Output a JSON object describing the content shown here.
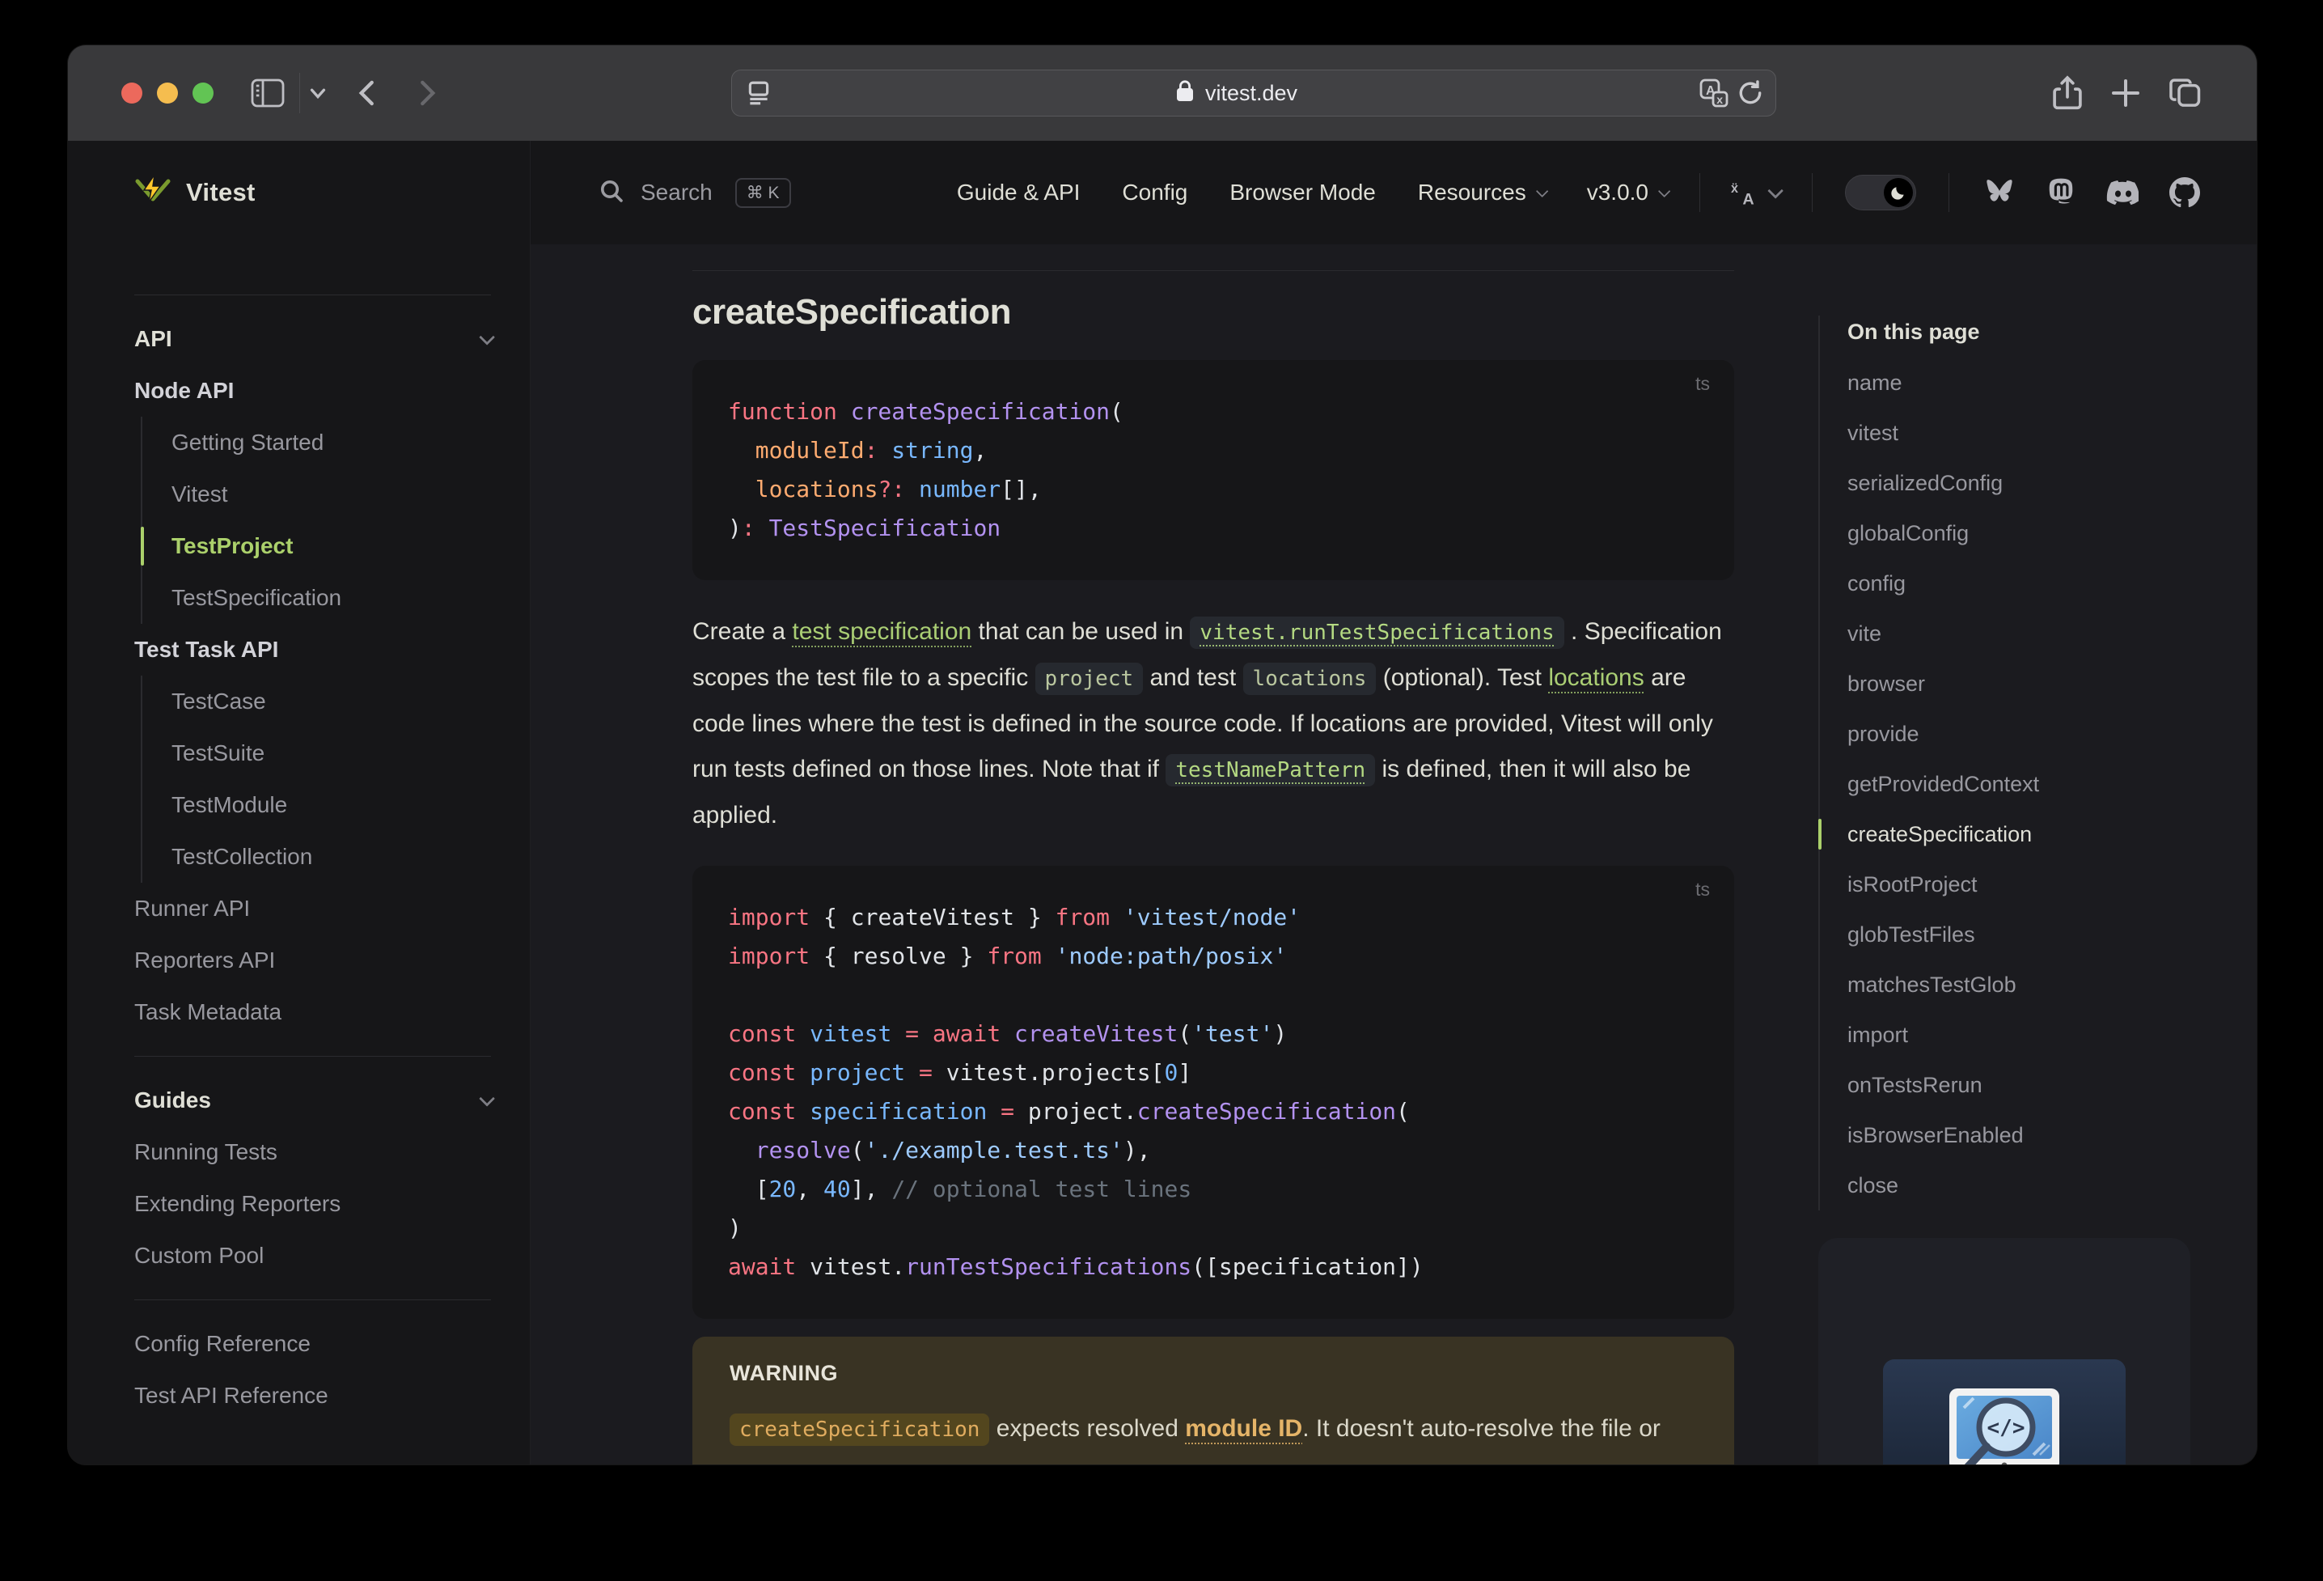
{
  "colors": {
    "brand": "#abd06b",
    "code_keyword": "#f97583",
    "code_function": "#b392f0",
    "code_string": "#9ecbff",
    "code_constant": "#79b8ff",
    "code_param": "#ffab70",
    "code_plain": "#e1e4e8",
    "code_comment": "#6a737d",
    "warning_accent": "#e5b468",
    "traffic_red": "#ec695c",
    "traffic_yellow": "#f5bd4f",
    "traffic_green": "#62c454"
  },
  "browser": {
    "url": "vitest.dev"
  },
  "navbar": {
    "search_label": "Search",
    "search_shortcut": "⌘ K",
    "links": [
      "Guide & API",
      "Config",
      "Browser Mode"
    ],
    "menus": [
      "Resources",
      "v3.0.0"
    ]
  },
  "sidebar": {
    "logo_text": "Vitest",
    "groups": [
      {
        "title": "API",
        "children": [
          {
            "type": "section",
            "label": "Node API"
          },
          {
            "type": "subitem",
            "label": "Getting Started"
          },
          {
            "type": "subitem",
            "label": "Vitest"
          },
          {
            "type": "subitem",
            "label": "TestProject",
            "active": true
          },
          {
            "type": "subitem",
            "label": "TestSpecification"
          },
          {
            "type": "section",
            "label": "Test Task API"
          },
          {
            "type": "subitem",
            "label": "TestCase"
          },
          {
            "type": "subitem",
            "label": "TestSuite"
          },
          {
            "type": "subitem",
            "label": "TestModule"
          },
          {
            "type": "subitem",
            "label": "TestCollection"
          },
          {
            "type": "item",
            "label": "Runner API"
          },
          {
            "type": "item",
            "label": "Reporters API"
          },
          {
            "type": "item",
            "label": "Task Metadata"
          }
        ]
      },
      {
        "title": "Guides",
        "children": [
          {
            "type": "item",
            "label": "Running Tests"
          },
          {
            "type": "item",
            "label": "Extending Reporters"
          },
          {
            "type": "item",
            "label": "Custom Pool"
          }
        ]
      },
      {
        "title": null,
        "children": [
          {
            "type": "item",
            "label": "Config Reference"
          },
          {
            "type": "item",
            "label": "Test API Reference"
          }
        ]
      }
    ]
  },
  "doc": {
    "heading": "createSpecification",
    "code_blocks": [
      {
        "lang": "ts",
        "lines": [
          [
            [
              "k",
              "function"
            ],
            [
              "d",
              " "
            ],
            [
              "f",
              "createSpecification"
            ],
            [
              "d",
              "("
            ]
          ],
          [
            [
              "d",
              "  "
            ],
            [
              "p",
              "moduleId"
            ],
            [
              "k",
              ":"
            ],
            [
              "d",
              " "
            ],
            [
              "v",
              "string"
            ],
            [
              "d",
              ","
            ]
          ],
          [
            [
              "d",
              "  "
            ],
            [
              "p",
              "locations"
            ],
            [
              "k",
              "?:"
            ],
            [
              "d",
              " "
            ],
            [
              "v",
              "number"
            ],
            [
              "d",
              "[],"
            ]
          ],
          [
            [
              "d",
              ")"
            ],
            [
              "k",
              ":"
            ],
            [
              "d",
              " "
            ],
            [
              "f",
              "TestSpecification"
            ]
          ]
        ]
      },
      {
        "lang": "ts",
        "lines": [
          [
            [
              "k",
              "import"
            ],
            [
              "d",
              " { createVitest } "
            ],
            [
              "k",
              "from"
            ],
            [
              "d",
              " "
            ],
            [
              "s",
              "'vitest/node'"
            ]
          ],
          [
            [
              "k",
              "import"
            ],
            [
              "d",
              " { resolve } "
            ],
            [
              "k",
              "from"
            ],
            [
              "d",
              " "
            ],
            [
              "s",
              "'node:path/posix'"
            ]
          ],
          [],
          [
            [
              "k",
              "const"
            ],
            [
              "d",
              " "
            ],
            [
              "v",
              "vitest"
            ],
            [
              "d",
              " "
            ],
            [
              "k",
              "="
            ],
            [
              "d",
              " "
            ],
            [
              "k",
              "await"
            ],
            [
              "d",
              " "
            ],
            [
              "f",
              "createVitest"
            ],
            [
              "d",
              "("
            ],
            [
              "s",
              "'test'"
            ],
            [
              "d",
              ")"
            ]
          ],
          [
            [
              "k",
              "const"
            ],
            [
              "d",
              " "
            ],
            [
              "v",
              "project"
            ],
            [
              "d",
              " "
            ],
            [
              "k",
              "="
            ],
            [
              "d",
              " vitest.projects["
            ],
            [
              "v",
              "0"
            ],
            [
              "d",
              "]"
            ]
          ],
          [
            [
              "k",
              "const"
            ],
            [
              "d",
              " "
            ],
            [
              "v",
              "specification"
            ],
            [
              "d",
              " "
            ],
            [
              "k",
              "="
            ],
            [
              "d",
              " project."
            ],
            [
              "f",
              "createSpecification"
            ],
            [
              "d",
              "("
            ]
          ],
          [
            [
              "d",
              "  "
            ],
            [
              "f",
              "resolve"
            ],
            [
              "d",
              "("
            ],
            [
              "s",
              "'./example.test.ts'"
            ],
            [
              "d",
              "),"
            ]
          ],
          [
            [
              "d",
              "  ["
            ],
            [
              "v",
              "20"
            ],
            [
              "d",
              ", "
            ],
            [
              "v",
              "40"
            ],
            [
              "d",
              "], "
            ],
            [
              "c",
              "// optional test lines"
            ]
          ],
          [
            [
              "d",
              ")"
            ]
          ],
          [
            [
              "k",
              "await"
            ],
            [
              "d",
              " vitest."
            ],
            [
              "f",
              "runTestSpecifications"
            ],
            [
              "d",
              "([specification])"
            ]
          ]
        ]
      }
    ],
    "paragraph": [
      [
        "text",
        "Create a "
      ],
      [
        "link",
        "test specification"
      ],
      [
        "text",
        " that can be used in "
      ],
      [
        "codelink",
        "vitest.runTestSpecifications"
      ],
      [
        "text",
        " . Specification scopes the test file to a specific "
      ],
      [
        "code",
        "project"
      ],
      [
        "text",
        " and test "
      ],
      [
        "code",
        "locations"
      ],
      [
        "text",
        " (optional). Test "
      ],
      [
        "link",
        "locations"
      ],
      [
        "text",
        " are code lines where the test is defined in the source code. If locations are provided, Vitest will only run tests defined on those lines. Note that if "
      ],
      [
        "codelink",
        "testNamePattern"
      ],
      [
        "text",
        " is defined, then it will also be applied."
      ]
    ],
    "warning": {
      "title": "WARNING",
      "segments": [
        [
          "code",
          "createSpecification"
        ],
        [
          "text",
          " expects resolved "
        ],
        [
          "link",
          "module ID"
        ],
        [
          "text",
          ". It doesn't auto-resolve the file or check that it exists on the file system."
        ]
      ]
    }
  },
  "aside": {
    "title": "On this page",
    "items": [
      "name",
      "vitest",
      "serializedConfig",
      "globalConfig",
      "config",
      "vite",
      "browser",
      "provide",
      "getProvidedContext",
      "createSpecification",
      "isRootProject",
      "globTestFiles",
      "matchesTestGlob",
      "import",
      "onTestsRerun",
      "isBrowserEnabled",
      "close"
    ],
    "active": "createSpecification"
  }
}
